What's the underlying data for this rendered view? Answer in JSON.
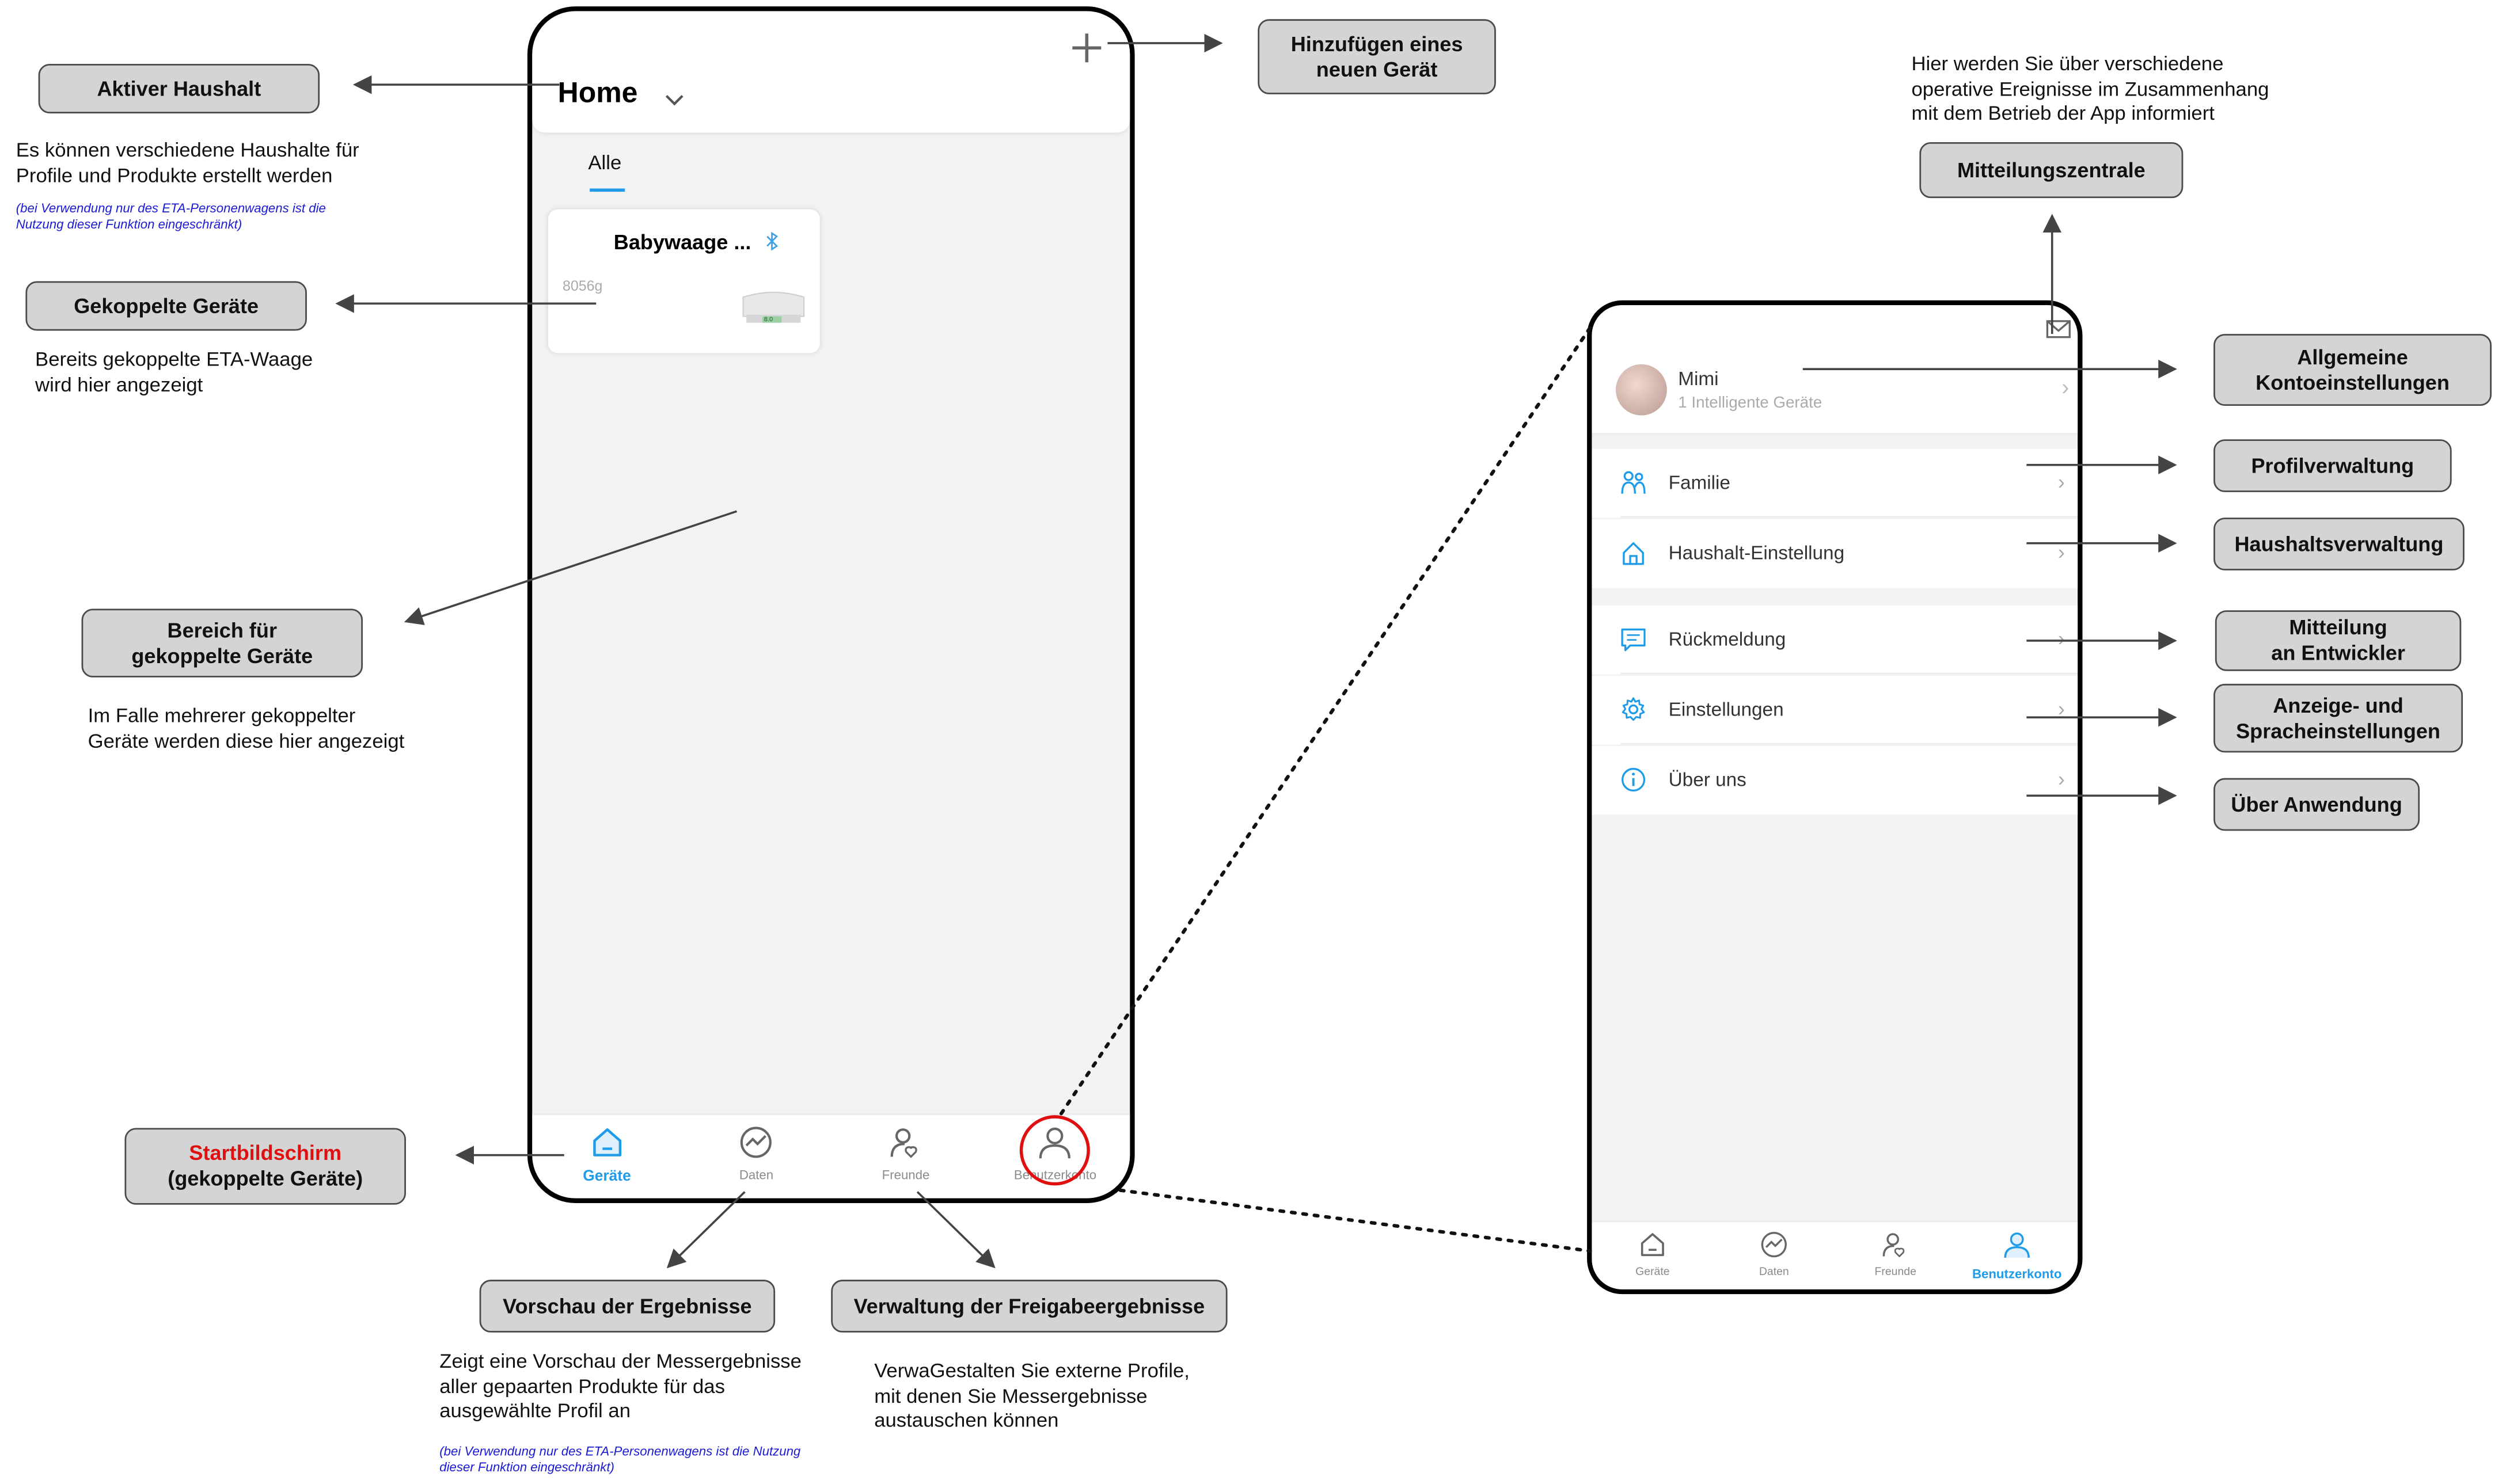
{
  "annotations": {
    "aktiver_haushalt": "Aktiver Haushalt",
    "aktiver_haushalt_desc": "Es können verschiedene Haushalte für\nProfile und Produkte erstellt werden",
    "aktiver_haushalt_note": "(bei Verwendung nur des ETA-Personenwagens ist die\nNutzung dieser Funktion eingeschränkt)",
    "gekoppelte_geraete": "Gekoppelte Geräte",
    "gekoppelte_geraete_desc": "Bereits gekoppelte ETA-Waage\nwird hier angezeigt",
    "bereich": "Bereich für\ngekoppelte Geräte",
    "bereich_desc": "Im Falle mehrerer gekoppelter\nGeräte werden diese hier angezeigt",
    "startbildschirm_red": "Startbildschirm",
    "startbildschirm_black": "(gekoppelte Geräte)",
    "hinzufuegen": "Hinzufügen eines\nneuen Gerät",
    "vorschau": "Vorschau der Ergebnisse",
    "vorschau_desc": "Zeigt eine Vorschau der Messergebnisse\naller gepaarten Produkte für das\nausgewählte Profil an",
    "vorschau_note": "(bei Verwendung nur des ETA-Personenwagens ist die Nutzung\ndieser Funktion eingeschränkt)",
    "verwaltung": "Verwaltung der Freigabeergebnisse",
    "verwaltung_desc": "VerwaGestalten Sie externe Profile,\nmit denen Sie Messergebnisse\naustauschen können",
    "mitteilungszentrale_desc": "Hier werden Sie über verschiedene\noperative Ereignisse im Zusammenhang\nmit dem Betrieb der App informiert",
    "mitteilungszentrale": "Mitteilungszentrale",
    "allgemeine": "Allgemeine\nKontoeinstellungen",
    "profilverwaltung": "Profilverwaltung",
    "haushaltsverwaltung": "Haushaltsverwaltung",
    "mitteilung_entwickler": "Mitteilung\nan Entwickler",
    "anzeige_sprache": "Anzeige- und\nSpracheinstellungen",
    "ueber_anwendung": "Über Anwendung"
  },
  "home_screen": {
    "title": "Home",
    "add_icon": "plus-icon",
    "tab_all": "Alle",
    "device_card": {
      "name": "Babywaage ...",
      "bluetooth_icon": "bluetooth-icon",
      "weight": "8056g",
      "scale_display": "8.0"
    },
    "nav": {
      "devices": "Geräte",
      "data": "Daten",
      "friends": "Freunde",
      "account": "Benutzerkonto"
    }
  },
  "account_screen": {
    "mail_icon": "mail-icon",
    "user_name": "Mimi",
    "user_devices": "1 Intelligente Geräte",
    "menu": {
      "family": "Familie",
      "household": "Haushalt-Einstellung",
      "feedback": "Rückmeldung",
      "settings": "Einstellungen",
      "about": "Über uns"
    },
    "nav": {
      "devices": "Geräte",
      "data": "Daten",
      "friends": "Freunde",
      "account": "Benutzerkonto"
    }
  },
  "colors": {
    "accent": "#1e9be9",
    "highlight_circle": "#e01010",
    "start_red": "#e01010",
    "note_blue": "#1a1ad6",
    "box_fill": "#d4d4d4",
    "screen_bg": "#f2f2f4"
  }
}
